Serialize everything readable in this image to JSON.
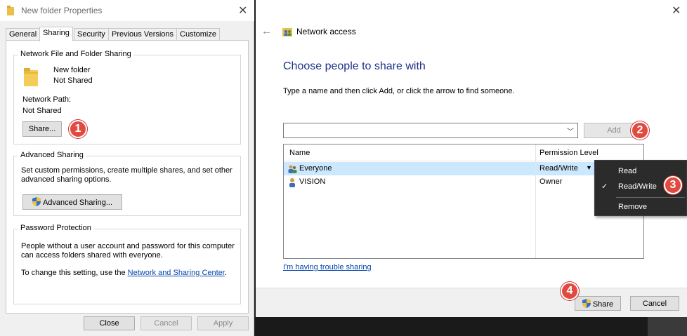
{
  "props": {
    "title": "New folder Properties",
    "tabs": [
      "General",
      "Sharing",
      "Security",
      "Previous Versions",
      "Customize"
    ],
    "active_tab": "Sharing",
    "network_sharing": {
      "legend": "Network File and Folder Sharing",
      "folder_name": "New folder",
      "folder_status": "Not Shared",
      "path_label": "Network Path:",
      "path_value": "Not Shared",
      "share_button": "Share..."
    },
    "advanced_sharing": {
      "legend": "Advanced Sharing",
      "desc_line1": "Set custom permissions, create multiple shares, and set other",
      "desc_line2": "advanced sharing options.",
      "button": "Advanced Sharing..."
    },
    "password_protection": {
      "legend": "Password Protection",
      "line1": "People without a user account and password for this computer",
      "line2": "can access folders shared with everyone.",
      "line3_prefix": "To change this setting, use the",
      "line3_link": "Network and Sharing Center",
      "line3_suffix": "."
    },
    "footer": {
      "close": "Close",
      "cancel": "Cancel",
      "apply": "Apply"
    }
  },
  "network_access": {
    "title": "Network access",
    "heading": "Choose people to share with",
    "instruction": "Type a name and then click Add, or click the arrow to find someone.",
    "name_input_value": "",
    "add_button": "Add",
    "columns": {
      "name": "Name",
      "permission": "Permission Level"
    },
    "rows": [
      {
        "name": "Everyone",
        "permission": "Read/Write"
      },
      {
        "name": "VISION",
        "permission": "Owner"
      }
    ],
    "trouble_link": "I'm having trouble sharing",
    "share_button": "Share",
    "cancel_button": "Cancel"
  },
  "permission_menu": {
    "items": [
      "Read",
      "Read/Write",
      "Remove"
    ],
    "checked": "Read/Write"
  },
  "badges": [
    "1",
    "2",
    "3",
    "4"
  ],
  "colors": {
    "badge": "#e04a3f",
    "heading": "#1e3287",
    "selection": "#cce8ff",
    "link": "#0645ad",
    "menu_bg": "#2b2b2b"
  }
}
